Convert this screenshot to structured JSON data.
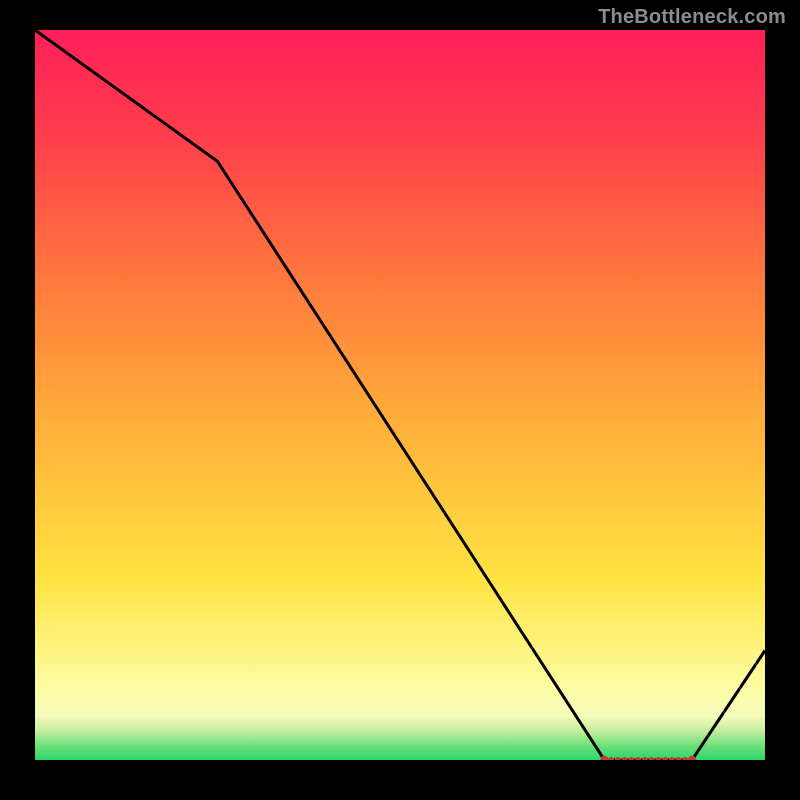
{
  "attribution": "TheBottleneck.com",
  "chart_data": {
    "type": "line",
    "title": "",
    "xlabel": "",
    "ylabel": "",
    "xlim": [
      0,
      100
    ],
    "ylim": [
      0,
      100
    ],
    "grid": false,
    "legend": false,
    "x": [
      0,
      25,
      78,
      90,
      100
    ],
    "values": [
      100,
      82,
      0,
      0,
      15
    ],
    "markers": {
      "y": 0,
      "x_range": [
        78,
        90
      ]
    },
    "background_gradient_stops": [
      {
        "y": 0,
        "color": "#2bd66b"
      },
      {
        "y": 2,
        "color": "#6fe07a"
      },
      {
        "y": 4,
        "color": "#c3ee9d"
      },
      {
        "y": 6,
        "color": "#f4fabb"
      },
      {
        "y": 10,
        "color": "#fdfca2"
      },
      {
        "y": 25,
        "color": "#ffe341"
      },
      {
        "y": 45,
        "color": "#ffb23a"
      },
      {
        "y": 65,
        "color": "#ff7b3c"
      },
      {
        "y": 85,
        "color": "#ff3f4b"
      },
      {
        "y": 100,
        "color": "#ff1f59"
      }
    ]
  }
}
